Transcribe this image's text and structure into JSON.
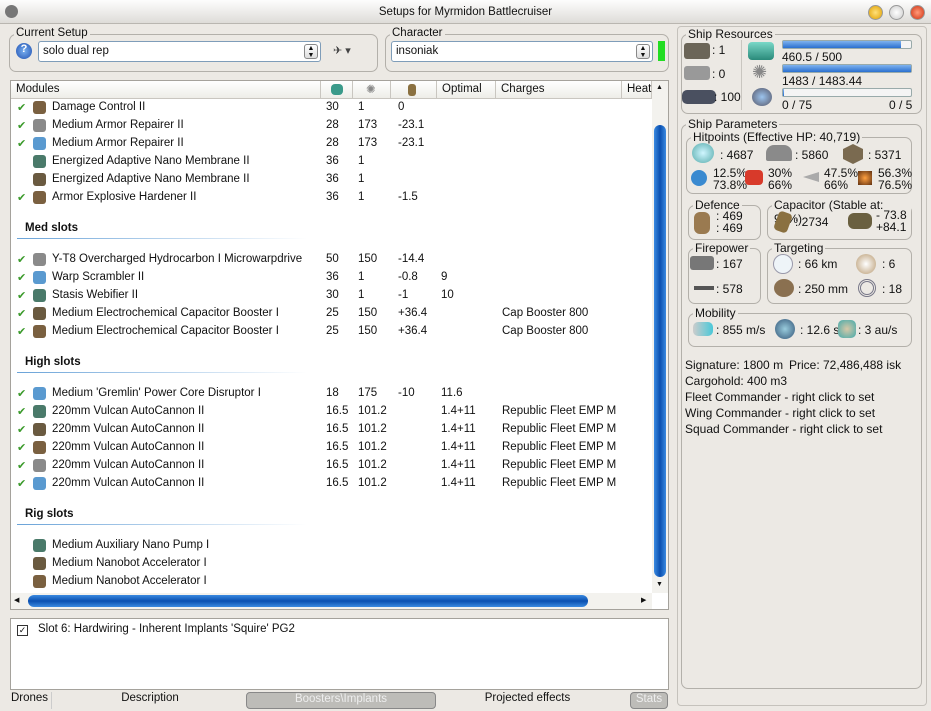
{
  "window": {
    "title": "Setups for Myrmidon Battlecruiser"
  },
  "setup": {
    "label": "Current Setup",
    "value": "solo dual rep"
  },
  "character": {
    "label": "Character",
    "value": "insoniak",
    "status_color": "#22dd22"
  },
  "table": {
    "headers": [
      "Modules",
      "cpu-icon",
      "powergrid-icon",
      "capacitor-icon",
      "Optimal",
      "Charges",
      "Heat"
    ],
    "sections": [
      {
        "title": "",
        "rows": [
          {
            "checked": true,
            "name": "Damage Control II",
            "cpu": "30",
            "pg": "1",
            "cap": "0",
            "optimal": "",
            "charges": ""
          },
          {
            "checked": true,
            "name": "Medium Armor Repairer II",
            "cpu": "28",
            "pg": "173",
            "cap": "-23.1",
            "optimal": "",
            "charges": ""
          },
          {
            "checked": true,
            "name": "Medium Armor Repairer II",
            "cpu": "28",
            "pg": "173",
            "cap": "-23.1",
            "optimal": "",
            "charges": ""
          },
          {
            "checked": false,
            "name": "Energized Adaptive Nano Membrane II",
            "cpu": "36",
            "pg": "1",
            "cap": "",
            "optimal": "",
            "charges": ""
          },
          {
            "checked": false,
            "name": "Energized Adaptive Nano Membrane II",
            "cpu": "36",
            "pg": "1",
            "cap": "",
            "optimal": "",
            "charges": ""
          },
          {
            "checked": true,
            "name": "Armor Explosive Hardener II",
            "cpu": "36",
            "pg": "1",
            "cap": "-1.5",
            "optimal": "",
            "charges": ""
          }
        ]
      },
      {
        "title": "Med slots",
        "rows": [
          {
            "checked": true,
            "name": "Y-T8 Overcharged Hydrocarbon I Microwarpdrive",
            "cpu": "50",
            "pg": "150",
            "cap": "-14.4",
            "optimal": "",
            "charges": ""
          },
          {
            "checked": true,
            "name": "Warp Scrambler II",
            "cpu": "36",
            "pg": "1",
            "cap": "-0.8",
            "optimal": "9",
            "charges": ""
          },
          {
            "checked": true,
            "name": "Stasis Webifier II",
            "cpu": "30",
            "pg": "1",
            "cap": "-1",
            "optimal": "10",
            "charges": ""
          },
          {
            "checked": true,
            "name": "Medium Electrochemical Capacitor Booster I",
            "cpu": "25",
            "pg": "150",
            "cap": "+36.4",
            "optimal": "",
            "charges": "Cap Booster 800"
          },
          {
            "checked": true,
            "name": "Medium Electrochemical Capacitor Booster I",
            "cpu": "25",
            "pg": "150",
            "cap": "+36.4",
            "optimal": "",
            "charges": "Cap Booster 800"
          }
        ]
      },
      {
        "title": "High slots",
        "rows": [
          {
            "checked": true,
            "name": "Medium 'Gremlin' Power Core Disruptor I",
            "cpu": "18",
            "pg": "175",
            "cap": "-10",
            "optimal": "11.6",
            "charges": ""
          },
          {
            "checked": true,
            "name": "220mm Vulcan AutoCannon II",
            "cpu": "16.5",
            "pg": "101.2",
            "cap": "",
            "optimal": "1.4+11",
            "charges": "Republic Fleet EMP M"
          },
          {
            "checked": true,
            "name": "220mm Vulcan AutoCannon II",
            "cpu": "16.5",
            "pg": "101.2",
            "cap": "",
            "optimal": "1.4+11",
            "charges": "Republic Fleet EMP M"
          },
          {
            "checked": true,
            "name": "220mm Vulcan AutoCannon II",
            "cpu": "16.5",
            "pg": "101.2",
            "cap": "",
            "optimal": "1.4+11",
            "charges": "Republic Fleet EMP M"
          },
          {
            "checked": true,
            "name": "220mm Vulcan AutoCannon II",
            "cpu": "16.5",
            "pg": "101.2",
            "cap": "",
            "optimal": "1.4+11",
            "charges": "Republic Fleet EMP M"
          },
          {
            "checked": true,
            "name": "220mm Vulcan AutoCannon II",
            "cpu": "16.5",
            "pg": "101.2",
            "cap": "",
            "optimal": "1.4+11",
            "charges": "Republic Fleet EMP M"
          }
        ]
      },
      {
        "title": "Rig slots",
        "rows": [
          {
            "checked": false,
            "name": "Medium Auxiliary Nano Pump I",
            "cpu": "",
            "pg": "",
            "cap": "",
            "optimal": "",
            "charges": ""
          },
          {
            "checked": false,
            "name": "Medium Nanobot Accelerator I",
            "cpu": "",
            "pg": "",
            "cap": "",
            "optimal": "",
            "charges": ""
          },
          {
            "checked": false,
            "name": "Medium Nanobot Accelerator I",
            "cpu": "",
            "pg": "",
            "cap": "",
            "optimal": "",
            "charges": ""
          }
        ]
      }
    ]
  },
  "implants": [
    {
      "checked": true,
      "name": "Slot 6: Hardwiring - Inherent Implants 'Squire' PG2"
    }
  ],
  "tabs": [
    {
      "label": "Drones"
    },
    {
      "label": "Description"
    },
    {
      "label": "Boosters\\Implants",
      "active": true
    },
    {
      "label": "Projected effects"
    },
    {
      "label": "Stats"
    }
  ],
  "resources": {
    "label": "Ship Resources",
    "turrets": ": 1",
    "launchers": ": 0",
    "drone_bay": ": 100",
    "cpu": {
      "text": "460.5 / 500",
      "fraction": 0.921
    },
    "powergrid": {
      "text": "1483 / 1483.44",
      "fraction": 0.9997
    },
    "calibration": {
      "text": "0 / 75",
      "fraction": 0
    },
    "rigs": "0 / 5"
  },
  "params": {
    "label": "Ship Parameters",
    "hitpoints": {
      "label": "Hitpoints (Effective HP: 40,719)",
      "shield": ": 4687",
      "armor": ": 5860",
      "structure": ": 5371",
      "resists": [
        {
          "top": "12.5%",
          "bottom": "73.8%"
        },
        {
          "top": "30%",
          "bottom": "66%"
        },
        {
          "top": "47.5%",
          "bottom": "66%"
        },
        {
          "top": "56.3%",
          "bottom": "76.5%"
        }
      ]
    },
    "defence": {
      "label": "Defence",
      "a": ": 469",
      "b": ": 469"
    },
    "capacitor": {
      "label": "Capacitor (Stable at: 95%)",
      "capacity": ": 2734",
      "use": "- 73.8",
      "recharge": "+84.1"
    },
    "firepower": {
      "label": "Firepower",
      "dps": ": 167",
      "volley": ": 578"
    },
    "targeting": {
      "label": "Targeting",
      "range": ": 66 km",
      "targets": ": 6",
      "resolution": ": 250 mm",
      "sensor": ": 18"
    },
    "mobility": {
      "label": "Mobility",
      "speed": ": 855 m/s",
      "align": ": 12.6 s",
      "warp": ": 3 au/s"
    }
  },
  "info": {
    "signature": "Signature: 1800 m",
    "price": "Price: 72,486,488 isk",
    "cargo": "Cargohold: 400 m3",
    "fleet": "Fleet Commander - right click to set",
    "wing": "Wing Commander - right click to set",
    "squad": "Squad Commander - right click to set"
  }
}
